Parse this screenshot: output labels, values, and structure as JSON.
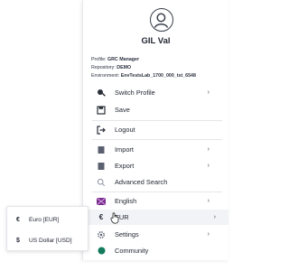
{
  "user": {
    "name": "GIL Val",
    "profile_label": "Profile:",
    "profile_value": "GRC Manager",
    "repository_label": "Repository:",
    "repository_value": "DEMO",
    "environment_label": "Environment:",
    "environment_value": "EnvTestsLab_1700_000_tst_6548"
  },
  "menu": {
    "switch_profile": "Switch Profile",
    "save": "Save",
    "logout": "Logout",
    "import": "Import",
    "export": "Export",
    "advanced_search": "Advanced Search",
    "english": "English",
    "eur": "EUR",
    "settings": "Settings",
    "community": "Community",
    "chevron": "›"
  },
  "currency_submenu": {
    "euro_symbol": "€",
    "euro_label": "Euro [EUR]",
    "usd_symbol": "$",
    "usd_label": "US Dollar [USD]"
  },
  "colors": {
    "community_dot": "#137a5c",
    "flag": "#7a2e8e"
  }
}
